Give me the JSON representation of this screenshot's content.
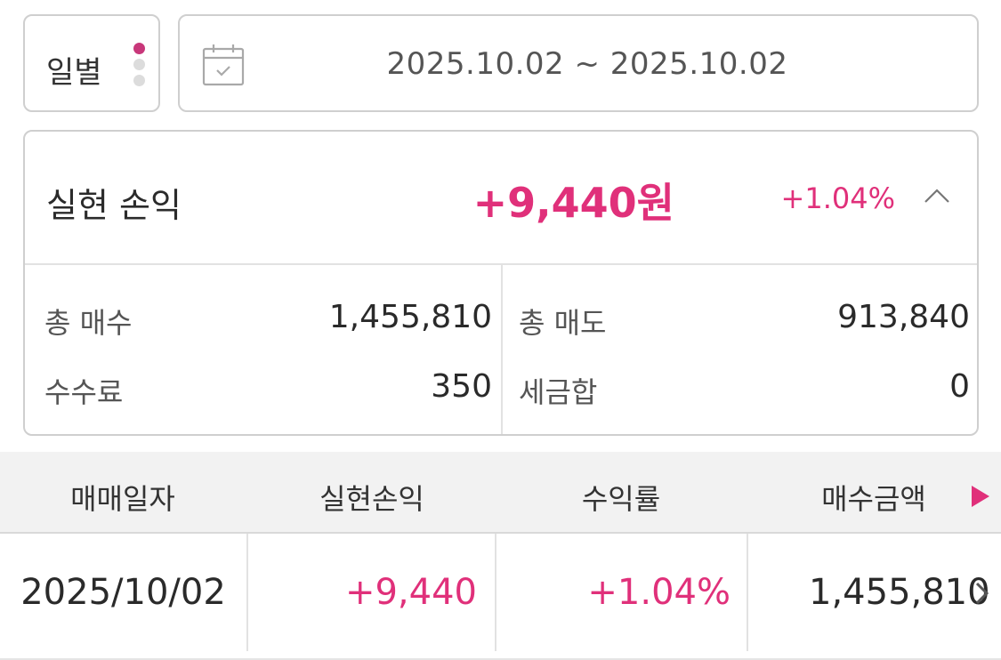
{
  "period": {
    "label": "일별",
    "active_dot": 0,
    "dot_colors": [
      "#c8377a",
      "#dcdcdc",
      "#dcdcdc"
    ]
  },
  "date_range": {
    "text": "2025.10.02 ~ 2025.10.02",
    "icon": "calendar-check-icon"
  },
  "summary": {
    "title": "실현 손익",
    "amount": "+9,440원",
    "rate": "+1.04%",
    "collapse_icon": "chevron-up-icon",
    "total_buy_label": "총 매수",
    "total_buy_value": "1,455,810",
    "total_sell_label": "총 매도",
    "total_sell_value": "913,840",
    "fee_label": "수수료",
    "fee_value": "350",
    "tax_label": "세금합",
    "tax_value": "0"
  },
  "table": {
    "headers": [
      "매매일자",
      "실현손익",
      "수익률",
      "매수금액"
    ],
    "scroll_icon": "play-right-icon",
    "rows": [
      {
        "date": "2025/10/02",
        "pnl": "+9,440",
        "rate": "+1.04%",
        "buy_amount": "1,455,810"
      }
    ]
  },
  "colors": {
    "accent": "#e0307a",
    "border": "#cfcfcf",
    "header_bg": "#f2f2f2"
  }
}
